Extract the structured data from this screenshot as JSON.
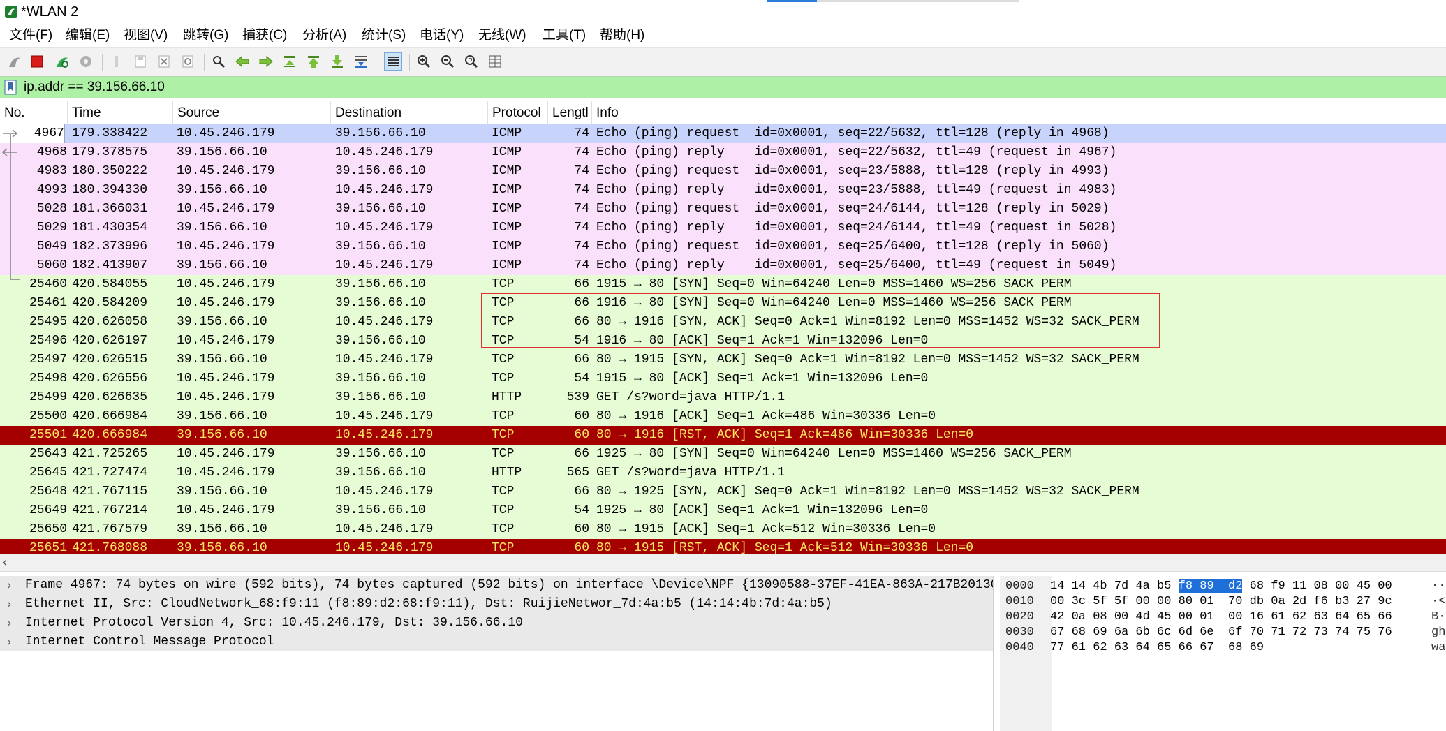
{
  "window": {
    "title": "*WLAN 2"
  },
  "menu": [
    "文件(F)",
    "编辑(E)",
    "视图(V)",
    "跳转(G)",
    "捕获(C)",
    "分析(A)",
    "统计(S)",
    "电话(Y)",
    "无线(W)",
    "工具(T)",
    "帮助(H)"
  ],
  "toolbar": {
    "icons": [
      "shark-fin-start-icon",
      "stop-capture-icon",
      "restart-capture-icon",
      "capture-options-icon",
      "open-file-icon",
      "save-file-icon",
      "close-file-icon",
      "reload-file-icon",
      "find-packet-icon",
      "go-back-icon",
      "go-forward-icon",
      "go-to-packet-icon",
      "go-first-packet-icon",
      "go-last-packet-icon",
      "auto-scroll-icon",
      "colorize-icon",
      "zoom-in-icon",
      "zoom-out-icon",
      "normal-size-icon",
      "resize-columns-icon"
    ]
  },
  "filter": {
    "value": "ip.addr == 39.156.66.10"
  },
  "columns": [
    "No.",
    "Time",
    "Source",
    "Destination",
    "Protocol",
    "Lengtl",
    "Info"
  ],
  "packets": [
    {
      "no": "4967",
      "time": "179.338422",
      "src": "10.45.246.179",
      "dst": "39.156.66.10",
      "proto": "ICMP",
      "len": "74",
      "info": "Echo (ping) request  id=0x0001, seq=22/5632, ttl=128 (reply in 4968)",
      "kind": "sel"
    },
    {
      "no": "4968",
      "time": "179.378575",
      "src": "39.156.66.10",
      "dst": "10.45.246.179",
      "proto": "ICMP",
      "len": "74",
      "info": "Echo (ping) reply    id=0x0001, seq=22/5632, ttl=49 (request in 4967)",
      "kind": "icmp"
    },
    {
      "no": "4983",
      "time": "180.350222",
      "src": "10.45.246.179",
      "dst": "39.156.66.10",
      "proto": "ICMP",
      "len": "74",
      "info": "Echo (ping) request  id=0x0001, seq=23/5888, ttl=128 (reply in 4993)",
      "kind": "icmp"
    },
    {
      "no": "4993",
      "time": "180.394330",
      "src": "39.156.66.10",
      "dst": "10.45.246.179",
      "proto": "ICMP",
      "len": "74",
      "info": "Echo (ping) reply    id=0x0001, seq=23/5888, ttl=49 (request in 4983)",
      "kind": "icmp"
    },
    {
      "no": "5028",
      "time": "181.366031",
      "src": "10.45.246.179",
      "dst": "39.156.66.10",
      "proto": "ICMP",
      "len": "74",
      "info": "Echo (ping) request  id=0x0001, seq=24/6144, ttl=128 (reply in 5029)",
      "kind": "icmp"
    },
    {
      "no": "5029",
      "time": "181.430354",
      "src": "39.156.66.10",
      "dst": "10.45.246.179",
      "proto": "ICMP",
      "len": "74",
      "info": "Echo (ping) reply    id=0x0001, seq=24/6144, ttl=49 (request in 5028)",
      "kind": "icmp"
    },
    {
      "no": "5049",
      "time": "182.373996",
      "src": "10.45.246.179",
      "dst": "39.156.66.10",
      "proto": "ICMP",
      "len": "74",
      "info": "Echo (ping) request  id=0x0001, seq=25/6400, ttl=128 (reply in 5060)",
      "kind": "icmp"
    },
    {
      "no": "5060",
      "time": "182.413907",
      "src": "39.156.66.10",
      "dst": "10.45.246.179",
      "proto": "ICMP",
      "len": "74",
      "info": "Echo (ping) reply    id=0x0001, seq=25/6400, ttl=49 (request in 5049)",
      "kind": "icmp"
    },
    {
      "no": "25460",
      "time": "420.584055",
      "src": "10.45.246.179",
      "dst": "39.156.66.10",
      "proto": "TCP",
      "len": "66",
      "info": "1915 → 80 [SYN] Seq=0 Win=64240 Len=0 MSS=1460 WS=256 SACK_PERM",
      "kind": "tcp"
    },
    {
      "no": "25461",
      "time": "420.584209",
      "src": "10.45.246.179",
      "dst": "39.156.66.10",
      "proto": "TCP",
      "len": "66",
      "info": "1916 → 80 [SYN] Seq=0 Win=64240 Len=0 MSS=1460 WS=256 SACK_PERM",
      "kind": "tcp"
    },
    {
      "no": "25495",
      "time": "420.626058",
      "src": "39.156.66.10",
      "dst": "10.45.246.179",
      "proto": "TCP",
      "len": "66",
      "info": "80 → 1916 [SYN, ACK] Seq=0 Ack=1 Win=8192 Len=0 MSS=1452 WS=32 SACK_PERM",
      "kind": "tcp"
    },
    {
      "no": "25496",
      "time": "420.626197",
      "src": "10.45.246.179",
      "dst": "39.156.66.10",
      "proto": "TCP",
      "len": "54",
      "info": "1916 → 80 [ACK] Seq=1 Ack=1 Win=132096 Len=0",
      "kind": "tcp"
    },
    {
      "no": "25497",
      "time": "420.626515",
      "src": "39.156.66.10",
      "dst": "10.45.246.179",
      "proto": "TCP",
      "len": "66",
      "info": "80 → 1915 [SYN, ACK] Seq=0 Ack=1 Win=8192 Len=0 MSS=1452 WS=32 SACK_PERM",
      "kind": "tcp"
    },
    {
      "no": "25498",
      "time": "420.626556",
      "src": "10.45.246.179",
      "dst": "39.156.66.10",
      "proto": "TCP",
      "len": "54",
      "info": "1915 → 80 [ACK] Seq=1 Ack=1 Win=132096 Len=0",
      "kind": "tcp"
    },
    {
      "no": "25499",
      "time": "420.626635",
      "src": "10.45.246.179",
      "dst": "39.156.66.10",
      "proto": "HTTP",
      "len": "539",
      "info": "GET /s?word=java HTTP/1.1",
      "kind": "http"
    },
    {
      "no": "25500",
      "time": "420.666984",
      "src": "39.156.66.10",
      "dst": "10.45.246.179",
      "proto": "TCP",
      "len": "60",
      "info": "80 → 1916 [ACK] Seq=1 Ack=486 Win=30336 Len=0",
      "kind": "tcp"
    },
    {
      "no": "25501",
      "time": "420.666984",
      "src": "39.156.66.10",
      "dst": "10.45.246.179",
      "proto": "TCP",
      "len": "60",
      "info": "80 → 1916 [RST, ACK] Seq=1 Ack=486 Win=30336 Len=0",
      "kind": "rst"
    },
    {
      "no": "25643",
      "time": "421.725265",
      "src": "10.45.246.179",
      "dst": "39.156.66.10",
      "proto": "TCP",
      "len": "66",
      "info": "1925 → 80 [SYN] Seq=0 Win=64240 Len=0 MSS=1460 WS=256 SACK_PERM",
      "kind": "tcp"
    },
    {
      "no": "25645",
      "time": "421.727474",
      "src": "10.45.246.179",
      "dst": "39.156.66.10",
      "proto": "HTTP",
      "len": "565",
      "info": "GET /s?word=java HTTP/1.1",
      "kind": "http"
    },
    {
      "no": "25648",
      "time": "421.767115",
      "src": "39.156.66.10",
      "dst": "10.45.246.179",
      "proto": "TCP",
      "len": "66",
      "info": "80 → 1925 [SYN, ACK] Seq=0 Ack=1 Win=8192 Len=0 MSS=1452 WS=32 SACK_PERM",
      "kind": "tcp"
    },
    {
      "no": "25649",
      "time": "421.767214",
      "src": "10.45.246.179",
      "dst": "39.156.66.10",
      "proto": "TCP",
      "len": "54",
      "info": "1925 → 80 [ACK] Seq=1 Ack=1 Win=132096 Len=0",
      "kind": "tcp"
    },
    {
      "no": "25650",
      "time": "421.767579",
      "src": "39.156.66.10",
      "dst": "10.45.246.179",
      "proto": "TCP",
      "len": "60",
      "info": "80 → 1915 [ACK] Seq=1 Ack=512 Win=30336 Len=0",
      "kind": "tcp"
    },
    {
      "no": "25651",
      "time": "421.768088",
      "src": "39.156.66.10",
      "dst": "10.45.246.179",
      "proto": "TCP",
      "len": "60",
      "info": "80 → 1915 [RST, ACK] Seq=1 Ack=512 Win=30336 Len=0",
      "kind": "rst"
    }
  ],
  "details": [
    "Frame 4967: 74 bytes on wire (592 bits), 74 bytes captured (592 bits) on interface \\Device\\NPF_{13090588-37EF-41EA-863A-217B20130",
    "Ethernet II, Src: CloudNetwork_68:f9:11 (f8:89:d2:68:f9:11), Dst: RuijieNetwor_7d:4a:b5 (14:14:4b:7d:4a:b5)",
    "Internet Protocol Version 4, Src: 10.45.246.179, Dst: 39.156.66.10",
    "Internet Control Message Protocol"
  ],
  "bytes": [
    {
      "off": "0000",
      "pre": "14 14 4b 7d 4a b5 ",
      "hl": "f8 89  d2",
      "post": " 68 f9 11 08 00 45 00",
      "ascii": "··"
    },
    {
      "off": "0010",
      "pre": "00 3c 5f 5f 00 00 80 01  70 db 0a 2d f6 b3 27 9c",
      "hl": "",
      "post": "",
      "ascii": "·<"
    },
    {
      "off": "0020",
      "pre": "42 0a 08 00 4d 45 00 01  00 16 61 62 63 64 65 66",
      "hl": "",
      "post": "",
      "ascii": "B·"
    },
    {
      "off": "0030",
      "pre": "67 68 69 6a 6b 6c 6d 6e  6f 70 71 72 73 74 75 76",
      "hl": "",
      "post": "",
      "ascii": "gh"
    },
    {
      "off": "0040",
      "pre": "77 61 62 63 64 65 66 67  68 69",
      "hl": "",
      "post": "",
      "ascii": "wa"
    }
  ]
}
